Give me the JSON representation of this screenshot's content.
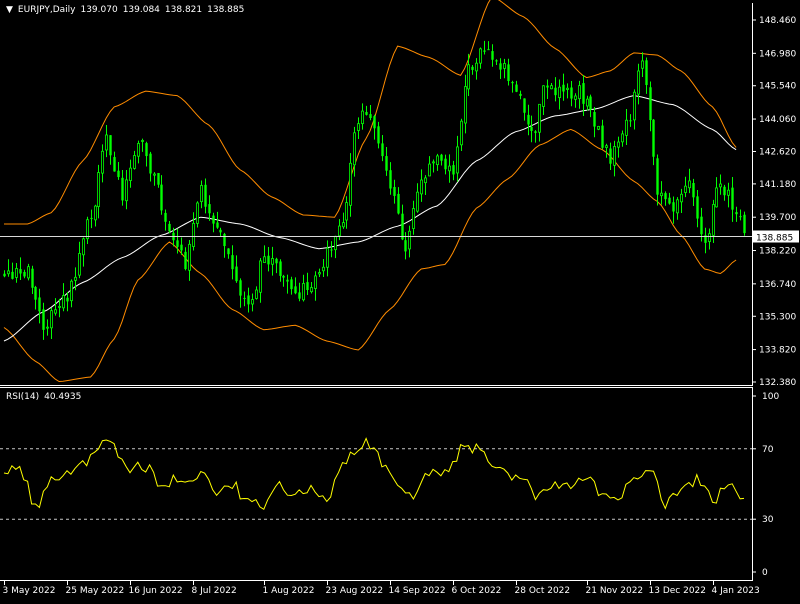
{
  "main_header": {
    "symbol": "EURJPY,Daily",
    "open": "139.070",
    "high": "139.084",
    "low": "138.821",
    "close": "138.885"
  },
  "rsi_header": {
    "label": "RSI(14)",
    "value": "40.4935"
  },
  "current_price_label": "138.885",
  "colors": {
    "background": "#000000",
    "bull_candle": "#00FF00",
    "bear_candle": "#00FF00",
    "ma": "#FFFFFF",
    "bollinger": "#FF8C00",
    "rsi": "#FFFF00",
    "grid_axis": "#FFFFFF"
  },
  "chart_data": [
    {
      "type": "candlestick",
      "title": "EURJPY,Daily",
      "ylim": [
        132.38,
        149.6
      ],
      "y_ticks": [
        "148.460",
        "146.980",
        "145.540",
        "144.060",
        "142.620",
        "141.180",
        "139.700",
        "138.220",
        "136.740",
        "135.300",
        "133.820",
        "132.380"
      ],
      "y_tick_values": [
        148.46,
        146.98,
        145.54,
        144.06,
        142.62,
        141.18,
        139.7,
        138.22,
        136.74,
        135.3,
        133.82,
        132.38
      ],
      "x_ticks": [
        "3 May 2022",
        "25 May 2022",
        "16 Jun 2022",
        "8 Jul 2022",
        "1 Aug 2022",
        "23 Aug 2022",
        "14 Sep 2022",
        "6 Oct 2022",
        "28 Oct 2022",
        "21 Nov 2022",
        "13 Dec 2022",
        "4 Jan 2023"
      ],
      "x_tick_bars": [
        0,
        16,
        32,
        48,
        66,
        82,
        98,
        114,
        130,
        148,
        164,
        180
      ],
      "bar_count": 189,
      "close_keypoints": [
        [
          0,
          137.1
        ],
        [
          6,
          137.4
        ],
        [
          10,
          134.9
        ],
        [
          16,
          136.2
        ],
        [
          22,
          139.8
        ],
        [
          26,
          143.3
        ],
        [
          30,
          140.6
        ],
        [
          34,
          143.1
        ],
        [
          38,
          141.5
        ],
        [
          42,
          139.0
        ],
        [
          46,
          137.7
        ],
        [
          50,
          140.8
        ],
        [
          54,
          139.3
        ],
        [
          58,
          137.6
        ],
        [
          62,
          135.5
        ],
        [
          66,
          137.9
        ],
        [
          70,
          137.2
        ],
        [
          74,
          136.3
        ],
        [
          78,
          136.6
        ],
        [
          82,
          138.0
        ],
        [
          86,
          139.4
        ],
        [
          90,
          144.2
        ],
        [
          94,
          143.8
        ],
        [
          98,
          141.2
        ],
        [
          102,
          138.2
        ],
        [
          106,
          141.5
        ],
        [
          110,
          142.5
        ],
        [
          114,
          141.6
        ],
        [
          118,
          146.4
        ],
        [
          122,
          147.2
        ],
        [
          126,
          146.6
        ],
        [
          130,
          145.3
        ],
        [
          134,
          143.3
        ],
        [
          138,
          145.7
        ],
        [
          142,
          145.2
        ],
        [
          146,
          145.3
        ],
        [
          150,
          143.9
        ],
        [
          154,
          142.2
        ],
        [
          158,
          143.7
        ],
        [
          162,
          146.5
        ],
        [
          166,
          140.9
        ],
        [
          170,
          140.0
        ],
        [
          174,
          141.0
        ],
        [
          178,
          138.7
        ],
        [
          182,
          141.3
        ],
        [
          186,
          139.9
        ],
        [
          188,
          138.885
        ]
      ],
      "ma_keypoints": [
        [
          0,
          134.2
        ],
        [
          10,
          135.5
        ],
        [
          20,
          136.8
        ],
        [
          30,
          137.9
        ],
        [
          40,
          138.9
        ],
        [
          50,
          139.7
        ],
        [
          60,
          139.4
        ],
        [
          70,
          138.8
        ],
        [
          80,
          138.3
        ],
        [
          90,
          138.6
        ],
        [
          100,
          139.3
        ],
        [
          110,
          140.2
        ],
        [
          120,
          142.2
        ],
        [
          130,
          143.5
        ],
        [
          140,
          144.2
        ],
        [
          150,
          144.5
        ],
        [
          160,
          145.1
        ],
        [
          170,
          144.7
        ],
        [
          180,
          143.6
        ],
        [
          186,
          142.7
        ]
      ],
      "bb_upper_keypoints": [
        [
          0,
          139.4
        ],
        [
          6,
          139.4
        ],
        [
          12,
          139.9
        ],
        [
          20,
          142.2
        ],
        [
          28,
          144.6
        ],
        [
          36,
          145.3
        ],
        [
          44,
          145.1
        ],
        [
          52,
          143.8
        ],
        [
          60,
          141.8
        ],
        [
          68,
          140.6
        ],
        [
          76,
          139.8
        ],
        [
          84,
          139.7
        ],
        [
          92,
          143.2
        ],
        [
          100,
          147.3
        ],
        [
          108,
          146.8
        ],
        [
          116,
          146.0
        ],
        [
          124,
          149.5
        ],
        [
          132,
          148.6
        ],
        [
          140,
          147.2
        ],
        [
          148,
          145.9
        ],
        [
          154,
          146.2
        ],
        [
          160,
          147.0
        ],
        [
          166,
          146.9
        ],
        [
          172,
          146.2
        ],
        [
          180,
          144.6
        ],
        [
          186,
          142.8
        ]
      ],
      "bb_lower_keypoints": [
        [
          0,
          134.8
        ],
        [
          8,
          133.3
        ],
        [
          14,
          132.4
        ],
        [
          22,
          132.6
        ],
        [
          28,
          134.3
        ],
        [
          34,
          136.9
        ],
        [
          42,
          138.6
        ],
        [
          50,
          137.2
        ],
        [
          58,
          135.6
        ],
        [
          66,
          134.7
        ],
        [
          74,
          134.9
        ],
        [
          82,
          134.2
        ],
        [
          90,
          133.8
        ],
        [
          98,
          135.6
        ],
        [
          106,
          137.4
        ],
        [
          112,
          137.6
        ],
        [
          120,
          140.1
        ],
        [
          128,
          141.4
        ],
        [
          136,
          142.9
        ],
        [
          144,
          143.6
        ],
        [
          152,
          142.7
        ],
        [
          160,
          141.3
        ],
        [
          166,
          140.4
        ],
        [
          172,
          138.9
        ],
        [
          178,
          137.4
        ],
        [
          182,
          137.2
        ],
        [
          186,
          137.8
        ]
      ],
      "current_price": 138.885
    },
    {
      "type": "line",
      "title": "RSI(14) 40.4935",
      "ylim": [
        0,
        100
      ],
      "y_ticks": [
        "100",
        "70",
        "30",
        "0"
      ],
      "y_tick_values": [
        100,
        70,
        30,
        0
      ],
      "levels": [
        70,
        30
      ],
      "series": [
        {
          "name": "RSI(14)",
          "x": [
            0,
            4,
            8,
            12,
            16,
            20,
            26,
            32,
            36,
            40,
            44,
            50,
            54,
            58,
            62,
            66,
            70,
            74,
            78,
            82,
            88,
            92,
            96,
            100,
            104,
            108,
            112,
            116,
            120,
            124,
            128,
            132,
            136,
            140,
            144,
            148,
            152,
            156,
            160,
            164,
            168,
            172,
            176,
            180,
            184,
            188
          ],
          "y": [
            58,
            60,
            37,
            52,
            55,
            60,
            76,
            58,
            60,
            49,
            53,
            56,
            44,
            50,
            40,
            36,
            48,
            42,
            49,
            43,
            66,
            75,
            62,
            50,
            43,
            58,
            55,
            69,
            70,
            60,
            56,
            51,
            43,
            51,
            48,
            55,
            43,
            38,
            55,
            60,
            38,
            46,
            53,
            40,
            52,
            41
          ]
        }
      ]
    }
  ]
}
